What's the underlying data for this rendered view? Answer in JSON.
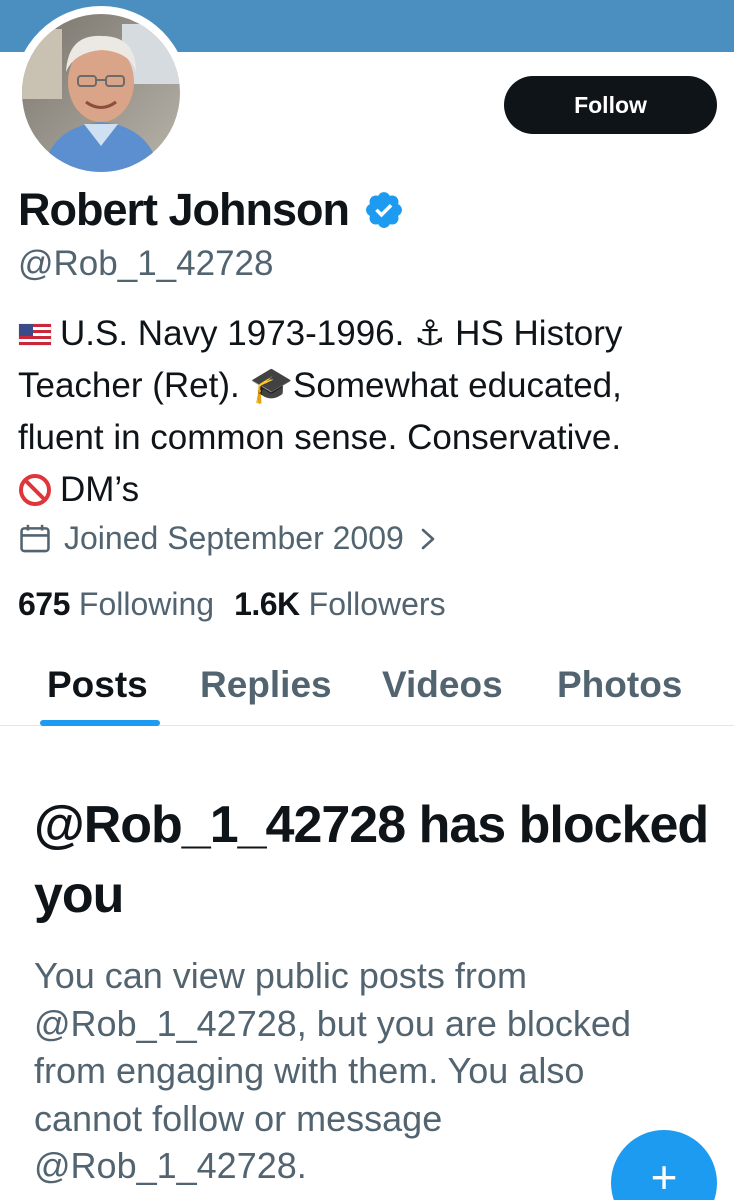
{
  "profile": {
    "display_name": "Robert Johnson",
    "handle": "@Rob_1_42728",
    "verified": true,
    "bio_lines": [
      {
        "emoji": "us-flag-icon",
        "text": "U.S. Navy 1973-1996. ⚓ HS History"
      },
      {
        "text": "Teacher (Ret). 🎓Somewhat educated,"
      },
      {
        "text": "fluent in common sense. Conservative."
      },
      {
        "emoji": "prohibited-icon",
        "text": "DM’s"
      }
    ],
    "joined": "Joined September 2009",
    "following_count": "675",
    "following_label": "Following",
    "followers_count": "1.6K",
    "followers_label": "Followers"
  },
  "actions": {
    "follow_label": "Follow"
  },
  "tabs": [
    {
      "label": "Posts",
      "active": true
    },
    {
      "label": "Replies",
      "active": false
    },
    {
      "label": "Videos",
      "active": false
    },
    {
      "label": "Photos",
      "active": false
    }
  ],
  "blocked": {
    "title": "@Rob_1_42728 has blocked you",
    "description_lines": [
      "You can view public posts from",
      "@Rob_1_42728, but you are blocked",
      "from engaging with them. You also",
      "cannot follow or message",
      "@Rob_1_42728."
    ]
  },
  "fab": {
    "label": "+"
  },
  "colors": {
    "banner": "#4a8fc0",
    "accent": "#1d9bf0",
    "text_primary": "#0f1419",
    "text_secondary": "#536471"
  }
}
